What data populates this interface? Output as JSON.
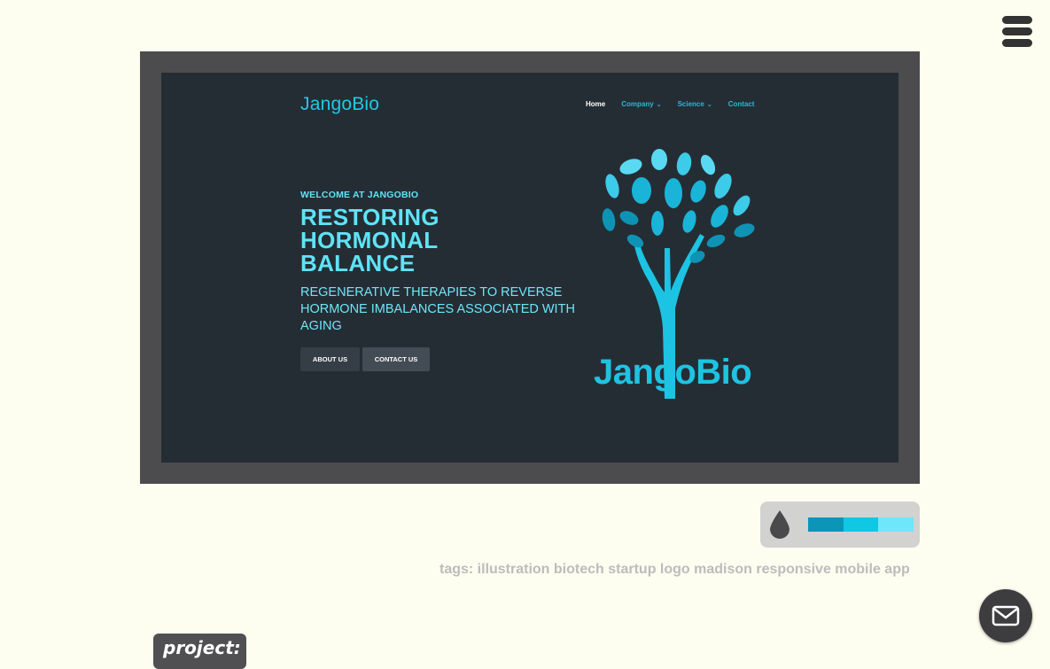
{
  "preview": {
    "site_logo": "JangoBio",
    "nav": [
      {
        "label": "Home",
        "active": true,
        "dropdown": false
      },
      {
        "label": "Company",
        "active": false,
        "dropdown": true
      },
      {
        "label": "Science",
        "active": false,
        "dropdown": true
      },
      {
        "label": "Contact",
        "active": false,
        "dropdown": false
      }
    ],
    "welcome": "WELCOME AT JANGOBIO",
    "headline": [
      "RESTORING",
      "HORMONAL",
      "BALANCE"
    ],
    "subhead": "REGENERATIVE THERAPIES TO REVERSE HORMONE IMBALANCES ASSOCIATED WITH AGING",
    "about_button": "ABOUT US",
    "contact_button": "CONTACT US",
    "brand_word": "JangoBio"
  },
  "palette": {
    "icon": "drop-icon",
    "colors": [
      "#0b96b8",
      "#10c8e4",
      "#6fe7fa"
    ]
  },
  "tags_line": "tags: illustration biotech startup logo madison responsive mobile app",
  "project_label": "project:",
  "icons": {
    "menu": "hamburger-menu-icon",
    "mail": "mail-icon"
  }
}
